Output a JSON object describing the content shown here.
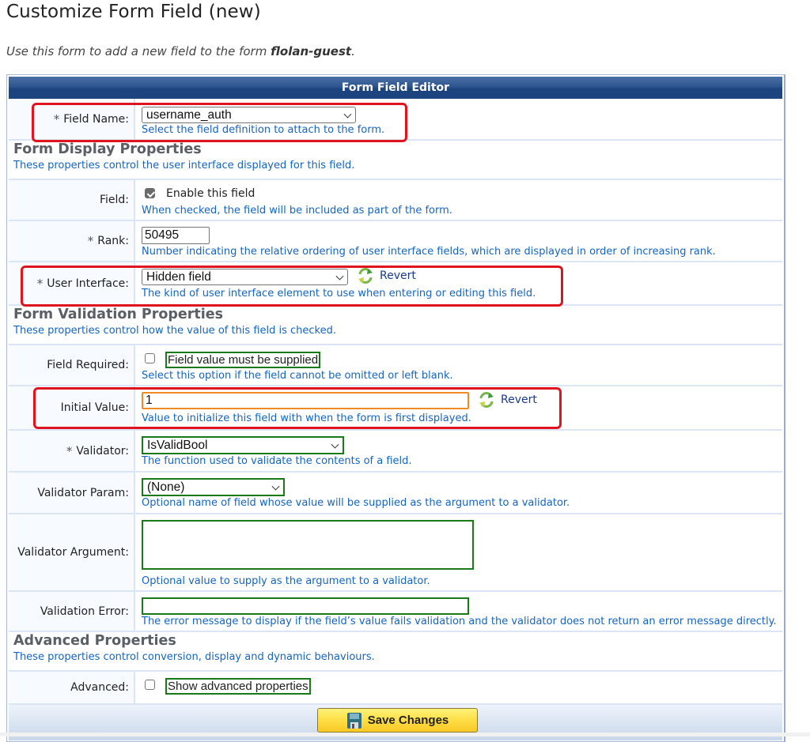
{
  "page": {
    "title": "Customize Form Field (new)",
    "intro_prefix": "Use this form to add a new field to the form ",
    "intro_form_name": "flolan-guest",
    "intro_suffix": "."
  },
  "editor": {
    "header": "Form Field Editor",
    "field_name": {
      "label": "Field Name:",
      "required": true,
      "value": "username_auth",
      "hint": "Select the field definition to attach to the form."
    },
    "display_section": {
      "title": "Form Display Properties",
      "subtitle": "These properties control the user interface displayed for this field."
    },
    "field_enable": {
      "label": "Field:",
      "checkbox_label": "Enable this field",
      "checked": true,
      "hint": "When checked, the field will be included as part of the form."
    },
    "rank": {
      "label": "Rank:",
      "required": true,
      "value": "50495",
      "hint": "Number indicating the relative ordering of user interface fields, which are displayed in order of increasing rank."
    },
    "user_interface": {
      "label": "User Interface:",
      "required": true,
      "value": "Hidden field",
      "revert_label": "Revert",
      "hint": "The kind of user interface element to use when entering or editing this field."
    },
    "validation_section": {
      "title": "Form Validation Properties",
      "subtitle": "These properties control how the value of this field is checked."
    },
    "field_required": {
      "label": "Field Required:",
      "checkbox_label": "Field value must be supplied",
      "checked": false,
      "hint": "Select this option if the field cannot be omitted or left blank."
    },
    "initial_value": {
      "label": "Initial Value:",
      "value": "1",
      "revert_label": "Revert",
      "hint": "Value to initialize this field with when the form is first displayed."
    },
    "validator": {
      "label": "Validator:",
      "required": true,
      "value": "IsValidBool",
      "hint": "The function used to validate the contents of a field."
    },
    "validator_param": {
      "label": "Validator Param:",
      "value": "(None)",
      "hint": "Optional name of field whose value will be supplied as the argument to a validator."
    },
    "validator_argument": {
      "label": "Validator Argument:",
      "value": "",
      "hint": "Optional value to supply as the argument to a validator."
    },
    "validation_error": {
      "label": "Validation Error:",
      "value": "",
      "hint": "The error message to display if the field’s value fails validation and the validator does not return an error message directly."
    },
    "advanced_section": {
      "title": "Advanced Properties",
      "subtitle": "These properties control conversion, display and dynamic behaviours."
    },
    "advanced": {
      "label": "Advanced:",
      "checkbox_label": "Show advanced properties",
      "checked": false
    },
    "save_label": "Save Changes"
  },
  "colors": {
    "header_blue": "#1d447e",
    "hint_blue": "#1565c0",
    "highlight_red": "#e0141e",
    "valid_green": "#1a7a1a",
    "focus_orange": "#f08a24",
    "save_yellow": "#ffe04a"
  }
}
